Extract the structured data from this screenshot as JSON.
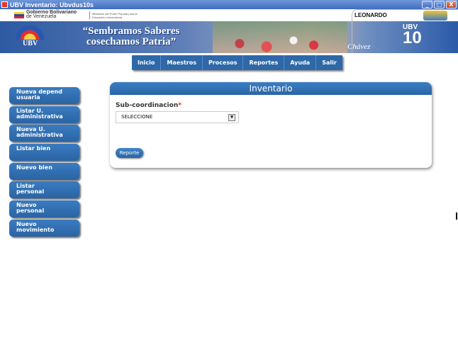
{
  "window": {
    "title": "UBV Inventario: Ubvdus10s",
    "controls": [
      "_",
      "□",
      "X"
    ]
  },
  "header": {
    "gov_line1": "Gobierno Bolivariano",
    "gov_line2": "de Venezuela",
    "ministry": "Ministerio del Poder Popular para la Educación Universitaria",
    "user": "LEONARDO",
    "slogan_line1": "“Sembramos Saberes",
    "slogan_line2": "cosechamos Patria”",
    "logo_text": "UBV",
    "signature": "Chávez",
    "anniv_top": "UBV",
    "anniv_number": "10"
  },
  "nav": [
    "Inicio",
    "Maestros",
    "Procesos",
    "Reportes",
    "Ayuda",
    "Salir"
  ],
  "sidebar": [
    {
      "line1": "Nueva depend",
      "line2": "usuaria"
    },
    {
      "line1": "Listar U.",
      "line2": "administrativa"
    },
    {
      "line1": "Nueva U.",
      "line2": "administrativa"
    },
    {
      "line1": "Listar bien",
      "line2": ""
    },
    {
      "line1": "Nuevo bien",
      "line2": ""
    },
    {
      "line1": "Listar",
      "line2": "personal"
    },
    {
      "line1": "Nuevo",
      "line2": "personal"
    },
    {
      "line1": "Nuevo",
      "line2": "movimiento"
    }
  ],
  "panel": {
    "title": "Inventario",
    "field_label": "Sub-coordinacion",
    "required_mark": "*",
    "select_value": "SELECCIONE",
    "report_button": "Reporte"
  },
  "colors": {
    "nav_blue": "#2e68a8",
    "titlebar_blue": "#3f6cc0",
    "required": "#dd2222"
  }
}
